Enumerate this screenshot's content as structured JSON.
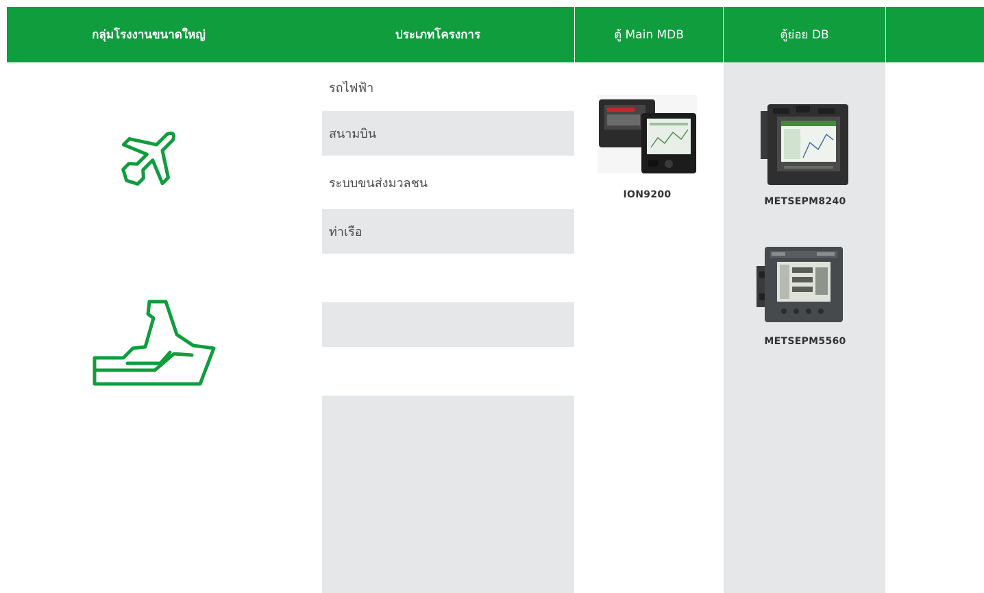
{
  "header": {
    "col_group": "กลุ่มโรงงานขนาดใหญ่",
    "col_project_type": "ประเภทโครงการ",
    "col_main_mdb": "ตู้ Main MDB",
    "col_sub_db": "ตู้ย่อย DB",
    "col_extra": ""
  },
  "colors": {
    "brand_green": "#0f9d3e",
    "band_grey": "#e6e7e9"
  },
  "group_icons": [
    {
      "name": "airplane-icon"
    },
    {
      "name": "ship-icon"
    }
  ],
  "project_types": [
    {
      "label": "รถไฟฟ้า",
      "shaded": false
    },
    {
      "label": "สนามบิน",
      "shaded": true
    },
    {
      "label": "ระบบขนส่งมวลชน",
      "shaded": false
    },
    {
      "label": "ท่าเรือ",
      "shaded": true
    },
    {
      "label": "",
      "shaded": false
    },
    {
      "label": "",
      "shaded": true
    },
    {
      "label": "",
      "shaded": false
    },
    {
      "label": "",
      "shaded": true
    }
  ],
  "main_mdb_products": [
    {
      "model": "ION9200"
    }
  ],
  "sub_db_products": [
    {
      "model": "METSEPM8240"
    },
    {
      "model": "METSEPM5560"
    }
  ]
}
